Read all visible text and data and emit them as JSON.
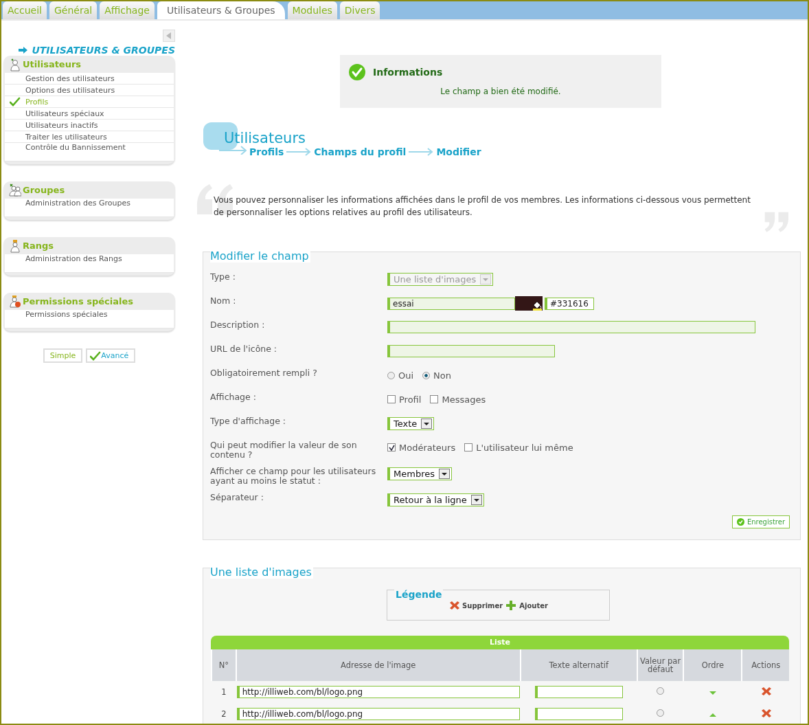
{
  "tabs": [
    {
      "label": "Accueil",
      "selected": false
    },
    {
      "label": "Général",
      "selected": false
    },
    {
      "label": "Affichage",
      "selected": false
    },
    {
      "label": "Utilisateurs & Groupes",
      "selected": true
    },
    {
      "label": "Modules",
      "selected": false
    },
    {
      "label": "Divers",
      "selected": false
    }
  ],
  "sidebar": {
    "title": "UTILISATEURS & GROUPES",
    "sections": [
      {
        "title": "Utilisateurs",
        "kind": "users",
        "items": [
          {
            "label": "Gestion des utilisateurs",
            "selected": false
          },
          {
            "label": "Options des utilisateurs",
            "selected": false
          },
          {
            "label": "Profils",
            "selected": true
          },
          {
            "label": "Utilisateurs spéciaux",
            "selected": false
          },
          {
            "label": "Utilisateurs inactifs",
            "selected": false
          },
          {
            "label": "Traiter les utilisateurs",
            "selected": false
          },
          {
            "label": "Contrôle du Bannissement",
            "selected": false
          }
        ]
      },
      {
        "title": "Groupes",
        "kind": "groups",
        "items": [
          {
            "label": "Administration des Groupes",
            "selected": false
          }
        ]
      },
      {
        "title": "Rangs",
        "kind": "ranks",
        "items": [
          {
            "label": "Administration des Rangs",
            "selected": false
          }
        ]
      },
      {
        "title": "Permissions spéciales",
        "kind": "permissions",
        "items": [
          {
            "label": "Permissions spéciales",
            "selected": false
          }
        ]
      }
    ],
    "modes": [
      {
        "label": "Simple",
        "selected": false
      },
      {
        "label": "Avancé",
        "selected": true
      }
    ]
  },
  "info": {
    "title": "Informations",
    "message": "Le champ a bien été modifié."
  },
  "header": {
    "title": "Utilisateurs",
    "breadcrumb": [
      "Profils",
      "Champs du profil",
      "Modifier"
    ]
  },
  "intro": "Vous pouvez personnaliser les informations affichées dans le profil de vos membres. Les informations ci-dessous vous permettent de personnaliser les options relatives au profil des utilisateurs.",
  "form": {
    "legend": "Modifier le champ",
    "rows": [
      {
        "label": "Type :",
        "kind": "select",
        "value": "Une liste d'images",
        "disabled": true
      },
      {
        "label": "Nom :",
        "kind": "name_color",
        "value": "essai",
        "color_value": "#331616"
      },
      {
        "label": "Description :",
        "kind": "text"
      },
      {
        "label": "URL de l'icône :",
        "kind": "text"
      },
      {
        "label": "Obligatoirement rempli ?",
        "kind": "radio",
        "options": [
          {
            "label": "Oui",
            "selected": false
          },
          {
            "label": "Non",
            "selected": true
          }
        ]
      },
      {
        "label": "Affichage :",
        "kind": "checkbox",
        "options": [
          {
            "label": "Profil",
            "checked": false
          },
          {
            "label": "Messages",
            "checked": false
          }
        ]
      },
      {
        "label": "Type d'affichage :",
        "kind": "select",
        "value": "Texte",
        "disabled": false
      },
      {
        "label": "Qui peut modifier la valeur de son contenu ?",
        "kind": "checkbox",
        "options": [
          {
            "label": "Modérateurs",
            "checked": true
          },
          {
            "label": "L'utilisateur lui même",
            "checked": false
          }
        ]
      },
      {
        "label": "Afficher ce champ pour les utilisateurs ayant au moins le statut :",
        "kind": "select",
        "value": "Membres",
        "disabled": false
      },
      {
        "label": "Séparateur :",
        "kind": "select",
        "value": "Retour à la ligne",
        "disabled": false
      }
    ],
    "save": "Enregistrer"
  },
  "list": {
    "legend": "Une liste d'images",
    "legend_box": {
      "title": "Légende",
      "items": [
        {
          "kind": "delete",
          "label": "Supprimer"
        },
        {
          "kind": "add",
          "label": "Ajouter"
        }
      ]
    },
    "table": {
      "title": "Liste",
      "columns": [
        "N°",
        "Adresse de l'image",
        "Texte alternatif",
        "Valeur par défaut",
        "Ordre",
        "Actions"
      ],
      "rows": [
        {
          "number": "1",
          "url": "http://illiweb.com/bl/logo.png",
          "default": false,
          "kind": "move_down"
        },
        {
          "number": "2",
          "url": "http://illiweb.com/bl/logo.png",
          "default": false,
          "kind": "move_up"
        }
      ]
    }
  }
}
